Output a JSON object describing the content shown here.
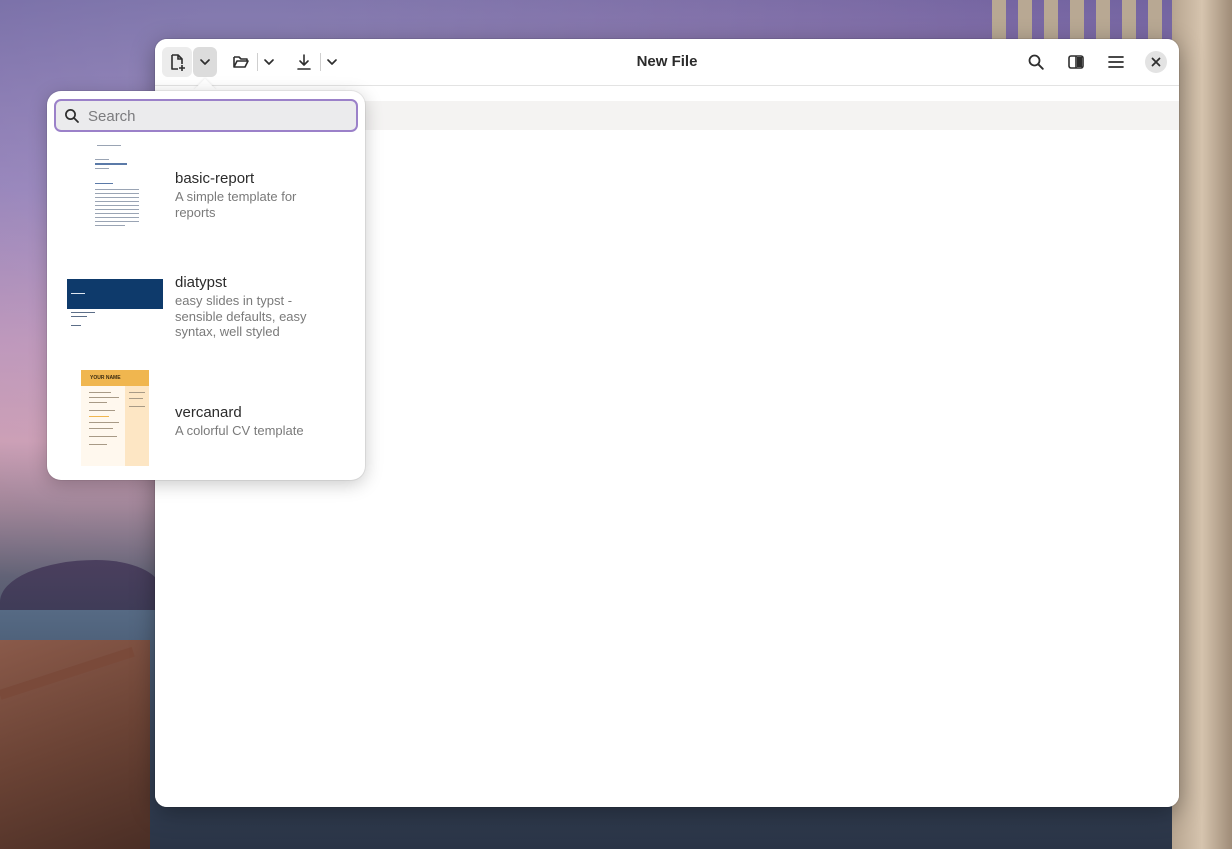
{
  "window": {
    "title": "New File",
    "buttons": {
      "new_file_icon": "new-file-icon",
      "new_file_menu_icon": "chevron-down-icon",
      "open_icon": "folder-open-icon",
      "open_menu_icon": "chevron-down-icon",
      "save_icon": "download-icon",
      "save_menu_icon": "chevron-down-icon",
      "search_icon": "search-icon",
      "sidebar_icon": "split-view-icon",
      "menu_icon": "hamburger-menu-icon",
      "close_icon": "close-icon"
    }
  },
  "template_popover": {
    "search": {
      "placeholder": "Search",
      "value": ""
    },
    "templates": [
      {
        "name": "basic-report",
        "description": "A simple template for reports"
      },
      {
        "name": "diatypst",
        "description": "easy slides in typst - sensible defaults, easy syntax, well styled"
      },
      {
        "name": "vercanard",
        "description": "A colorful CV template"
      }
    ],
    "thumbnail_texts": {
      "vercanard_heading": "YOUR NAME"
    }
  },
  "colors": {
    "accent_focus": "#9b81c9",
    "diatypst_band": "#0e3a6b",
    "vercanard_header": "#f0b64f"
  }
}
